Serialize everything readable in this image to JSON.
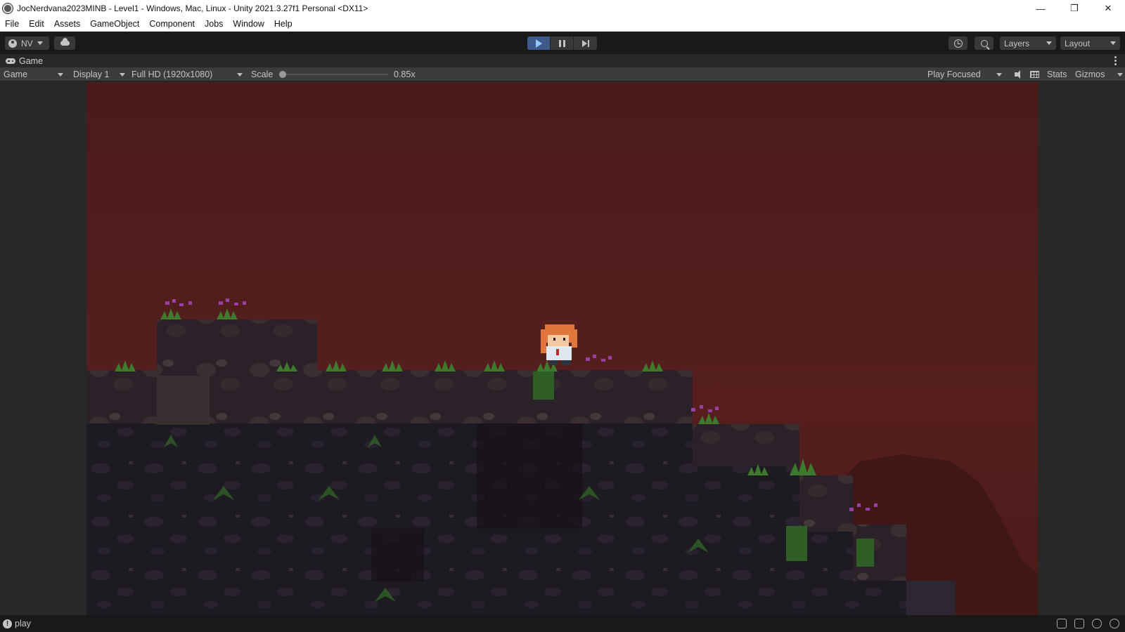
{
  "window": {
    "title": "JocNerdvana2023MINB - Level1 - Windows, Mac, Linux - Unity 2021.3.27f1 Personal <DX11>",
    "controls": {
      "minimize": "—",
      "maximize": "❐",
      "close": "✕"
    }
  },
  "menu": [
    "File",
    "Edit",
    "Assets",
    "GameObject",
    "Component",
    "Jobs",
    "Window",
    "Help"
  ],
  "toolbar": {
    "account_label": "NV",
    "play_state": "playing",
    "layers_label": "Layers",
    "layout_label": "Layout"
  },
  "game_tab": {
    "label": "Game"
  },
  "game_controls": {
    "view_mode": "Game",
    "display": "Display 1",
    "resolution": "Full HD (1920x1080)",
    "scale_label": "Scale",
    "scale_value": "0.85x",
    "scale_fraction": 0.0,
    "play_mode": "Play Focused",
    "stats_label": "Stats",
    "gizmos_label": "Gizmos"
  },
  "status": {
    "text": "play"
  },
  "colors": {
    "sky": "#501e1c",
    "rock_dark": "#1f1a22",
    "rock_mid": "#2e2630",
    "grass": "#3d7a2e",
    "flower": "#9a3fa8",
    "player_hair": "#e0763a",
    "play_button": "#3d5a8a"
  }
}
